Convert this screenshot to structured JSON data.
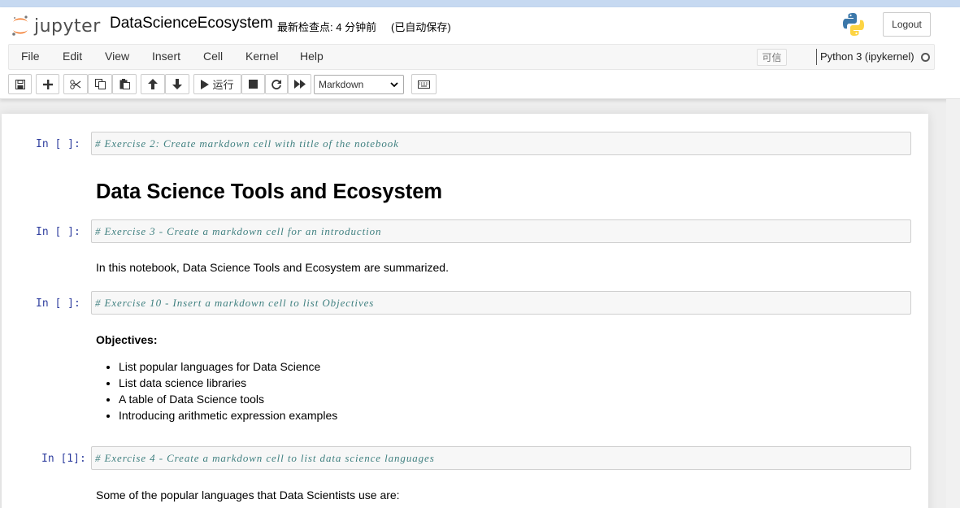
{
  "header": {
    "logo_text": "jupyter",
    "notebook_name": "DataScienceEcosystem",
    "checkpoint": "最新检查点: 4 分钟前",
    "autosave": "(已自动保存)",
    "logout_label": "Logout",
    "python_logo_icon": "python-icon"
  },
  "menubar": {
    "items": [
      "File",
      "Edit",
      "View",
      "Insert",
      "Cell",
      "Kernel",
      "Help"
    ],
    "trusted_label": "可信",
    "kernel_name": "Python 3 (ipykernel)"
  },
  "toolbar": {
    "buttons": [
      "save-icon",
      "plus-icon",
      "cut-icon",
      "copy-icon",
      "paste-icon",
      "arrow-up-icon",
      "arrow-down-icon",
      "play-icon",
      "stop-icon",
      "restart-icon",
      "fast-forward-icon",
      "keyboard-icon"
    ],
    "run_label": "运行",
    "cell_type": "Markdown"
  },
  "cells": {
    "c1": {
      "prompt": "In [ ]:",
      "code": "# Exercise 2: Create markdown cell with title of the notebook"
    },
    "h1": "Data Science Tools and Ecosystem",
    "c2": {
      "prompt": "In [ ]:",
      "code": "# Exercise 3 - Create a markdown cell for an introduction"
    },
    "intro": "In this notebook, Data Science Tools and Ecosystem are summarized.",
    "c3": {
      "prompt": "In [ ]:",
      "code": "# Exercise 10 - Insert a markdown cell to list Objectives"
    },
    "objectives_heading": "Objectives:",
    "objectives": [
      "List popular languages for Data Science",
      "List data science libraries",
      "A table of Data Science tools",
      "Introducing arithmetic expression examples"
    ],
    "c4": {
      "prompt": "In [1]:",
      "code": "# Exercise 4 - Create a markdown cell to list data science languages"
    },
    "languages_intro": "Some of the popular languages that Data Scientists use are:"
  },
  "colors": {
    "prompt": "#303f9f",
    "comment": "#408080",
    "code_bg": "#f7f7f7",
    "jupyter_orange": "#f37726"
  }
}
